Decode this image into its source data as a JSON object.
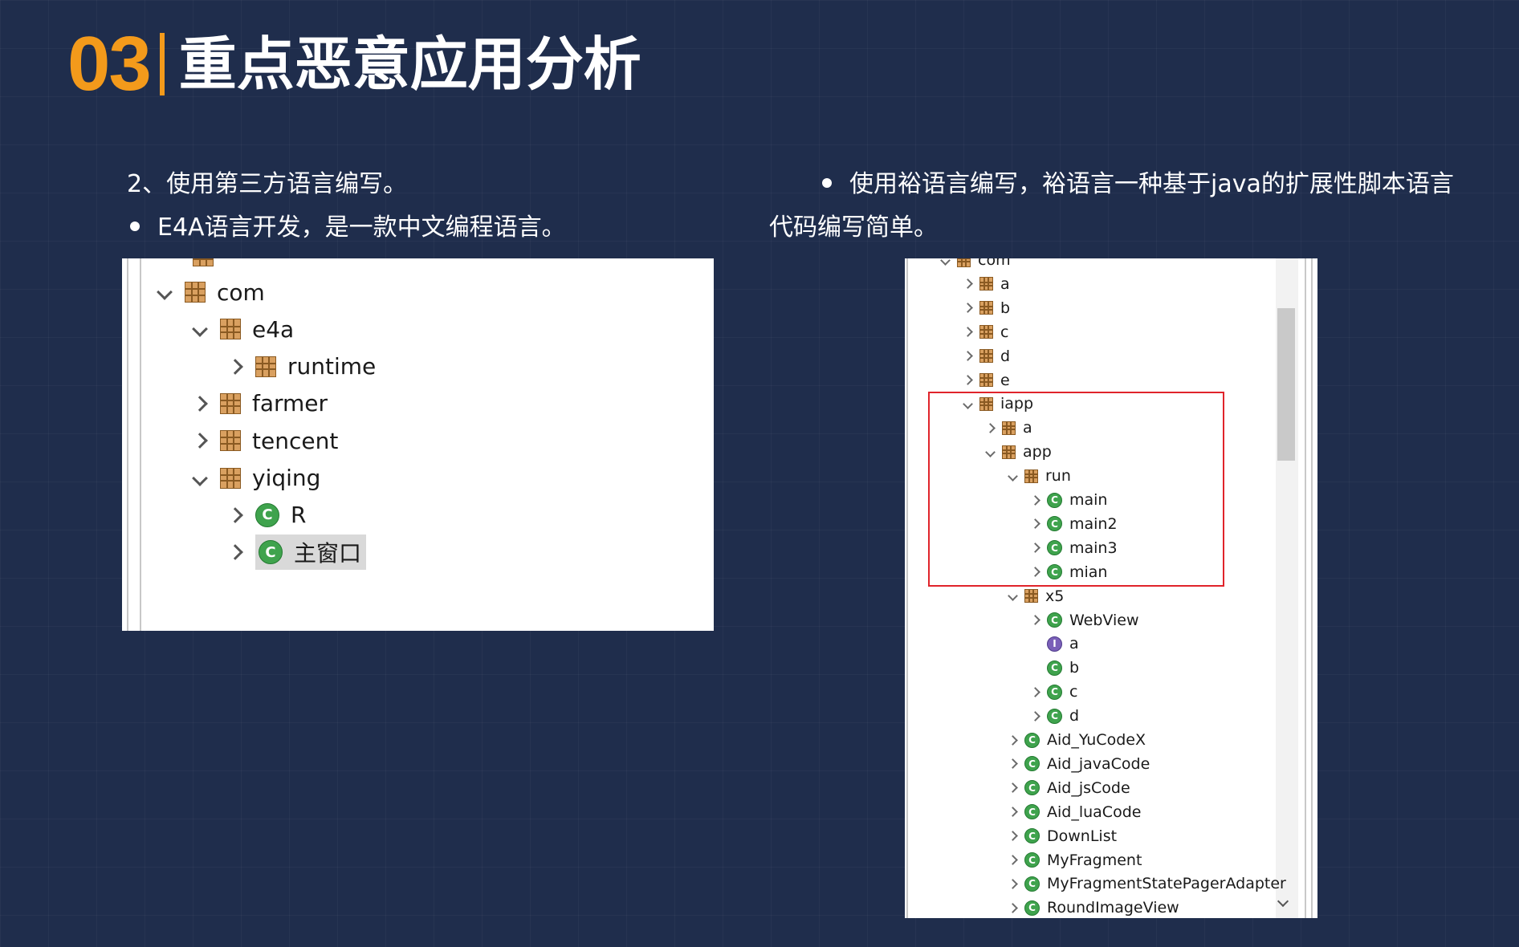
{
  "header": {
    "number": "03",
    "title": "重点恶意应用分析"
  },
  "left": {
    "heading": "2、使用第三方语言编写。",
    "bullet": "E4A语言开发，是一款中文编程语言。",
    "tree": [
      {
        "label": "com",
        "depth": 0,
        "expand": "down",
        "icon": "pkg"
      },
      {
        "label": "e4a",
        "depth": 1,
        "expand": "down",
        "icon": "pkg"
      },
      {
        "label": "runtime",
        "depth": 2,
        "expand": "right",
        "icon": "pkg"
      },
      {
        "label": "farmer",
        "depth": 1,
        "expand": "right",
        "icon": "pkg"
      },
      {
        "label": "tencent",
        "depth": 1,
        "expand": "right",
        "icon": "pkg"
      },
      {
        "label": "yiqing",
        "depth": 1,
        "expand": "down",
        "icon": "pkg"
      },
      {
        "label": "R",
        "depth": 2,
        "expand": "right",
        "icon": "class"
      },
      {
        "label": "主窗口",
        "depth": 2,
        "expand": "right",
        "icon": "class",
        "selected": true
      }
    ]
  },
  "right": {
    "bullet_line1": "使用裕语言编写，裕语言一种基于java的扩展性脚本语言",
    "bullet_line2": "代码编写简单。",
    "tree": [
      {
        "label": "com",
        "depth": 0,
        "expand": "down",
        "icon": "pkg"
      },
      {
        "label": "a",
        "depth": 1,
        "expand": "right",
        "icon": "pkg"
      },
      {
        "label": "b",
        "depth": 1,
        "expand": "right",
        "icon": "pkg"
      },
      {
        "label": "c",
        "depth": 1,
        "expand": "right",
        "icon": "pkg"
      },
      {
        "label": "d",
        "depth": 1,
        "expand": "right",
        "icon": "pkg"
      },
      {
        "label": "e",
        "depth": 1,
        "expand": "right",
        "icon": "pkg"
      },
      {
        "label": "iapp",
        "depth": 1,
        "expand": "down",
        "icon": "pkg"
      },
      {
        "label": "a",
        "depth": 2,
        "expand": "right",
        "icon": "pkg"
      },
      {
        "label": "app",
        "depth": 2,
        "expand": "down",
        "icon": "pkg"
      },
      {
        "label": "run",
        "depth": 3,
        "expand": "down",
        "icon": "pkg"
      },
      {
        "label": "main",
        "depth": 4,
        "expand": "right",
        "icon": "class"
      },
      {
        "label": "main2",
        "depth": 4,
        "expand": "right",
        "icon": "class"
      },
      {
        "label": "main3",
        "depth": 4,
        "expand": "right",
        "icon": "class"
      },
      {
        "label": "mian",
        "depth": 4,
        "expand": "right",
        "icon": "class"
      },
      {
        "label": "x5",
        "depth": 3,
        "expand": "down",
        "icon": "pkg"
      },
      {
        "label": "WebView",
        "depth": 4,
        "expand": "right",
        "icon": "class"
      },
      {
        "label": "a",
        "depth": 4,
        "expand": "none",
        "icon": "interface"
      },
      {
        "label": "b",
        "depth": 4,
        "expand": "none",
        "icon": "class"
      },
      {
        "label": "c",
        "depth": 4,
        "expand": "right",
        "icon": "class"
      },
      {
        "label": "d",
        "depth": 4,
        "expand": "right",
        "icon": "class"
      },
      {
        "label": "Aid_YuCodeX",
        "depth": 3,
        "expand": "right",
        "icon": "class"
      },
      {
        "label": "Aid_javaCode",
        "depth": 3,
        "expand": "right",
        "icon": "class"
      },
      {
        "label": "Aid_jsCode",
        "depth": 3,
        "expand": "right",
        "icon": "class"
      },
      {
        "label": "Aid_luaCode",
        "depth": 3,
        "expand": "right",
        "icon": "class"
      },
      {
        "label": "DownList",
        "depth": 3,
        "expand": "right",
        "icon": "class"
      },
      {
        "label": "MyFragment",
        "depth": 3,
        "expand": "right",
        "icon": "class"
      },
      {
        "label": "MyFragmentStatePagerAdapter",
        "depth": 3,
        "expand": "right",
        "icon": "class"
      },
      {
        "label": "RoundImageView",
        "depth": 3,
        "expand": "right",
        "icon": "class"
      }
    ]
  },
  "icons": {
    "package": "package-icon",
    "class": "class-icon",
    "interface": "interface-icon",
    "expanded": "chevron-down-icon",
    "collapsed": "chevron-right-icon"
  },
  "colors": {
    "background": "#1f2d4c",
    "accent": "#f39a1b",
    "highlight_box": "#e0242b",
    "class_icon": "#3fa34d",
    "interface_icon": "#7a5fb8"
  }
}
